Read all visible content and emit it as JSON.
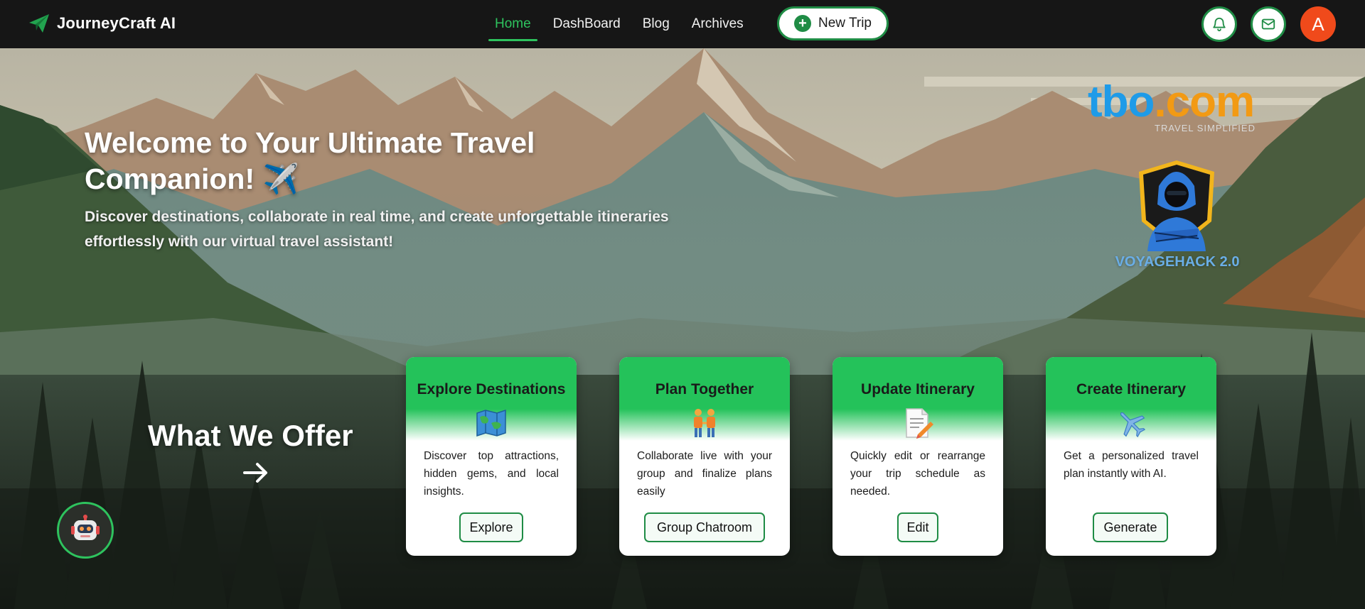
{
  "nav": {
    "brand": "JourneyCraft AI",
    "links": [
      "Home",
      "DashBoard",
      "Blog",
      "Archives"
    ],
    "new_trip": "New Trip",
    "avatar_letter": "A"
  },
  "hero": {
    "title": "Welcome to Your Ultimate Travel Companion! ✈️",
    "subtitle": "Discover destinations, collaborate in real time, and create unforgettable itineraries effortlessly with our virtual travel assistant!"
  },
  "sponsor": {
    "tbo_part1": "tbo",
    "tbo_part2": ".com",
    "tbo_tagline": "TRAVEL SIMPLIFIED",
    "event": "VOYAGEHACK 2.0"
  },
  "offer": {
    "title": "What We Offer"
  },
  "cards": [
    {
      "title": "Explore Destinations",
      "icon": "world-map-icon",
      "desc": "Discover top attractions, hidden gems, and local insights.",
      "button": "Explore"
    },
    {
      "title": "Plan Together",
      "icon": "people-holding-hands-icon",
      "desc": "Collaborate live with your group and finalize plans easily",
      "button": "Group Chatroom"
    },
    {
      "title": "Update Itinerary",
      "icon": "memo-pencil-icon",
      "desc": "Quickly edit or rearrange your trip schedule as needed.",
      "button": "Edit"
    },
    {
      "title": "Create Itinerary",
      "icon": "airplane-icon",
      "desc": "Get a personalized travel plan instantly with AI.",
      "button": "Generate"
    }
  ],
  "colors": {
    "accent": "#2ec35e",
    "dark_green": "#1f8c45",
    "navbar": "#161616",
    "avatar": "#f04a1b",
    "tbo_blue": "#1e9be8",
    "tbo_orange": "#f29a14"
  }
}
